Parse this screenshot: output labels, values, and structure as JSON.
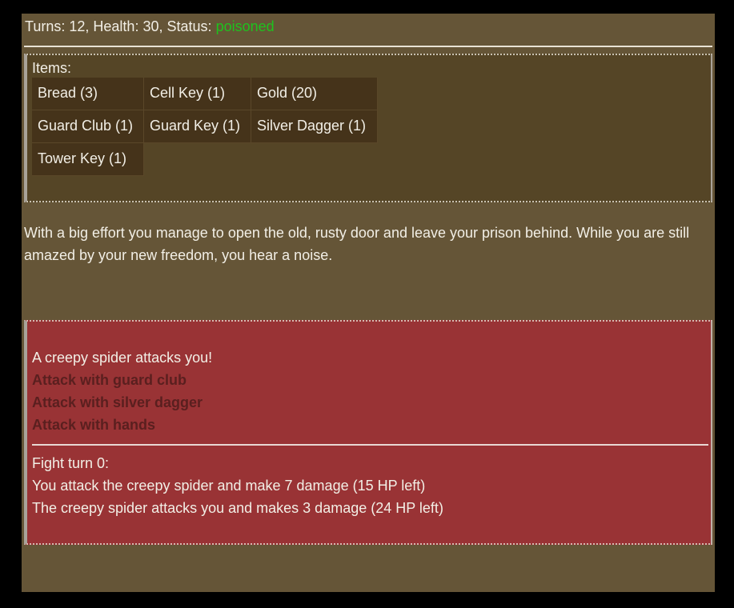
{
  "status": {
    "turns_label": "Turns:",
    "turns": "12",
    "health_label": "Health:",
    "health": "30",
    "status_label": "Status:",
    "status_value": "poisoned",
    "status_color": "#1ec21e"
  },
  "inventory": {
    "label": "Items:",
    "items": [
      {
        "name": "Bread",
        "count": 3,
        "label": "Bread (3)"
      },
      {
        "name": "Cell Key",
        "count": 1,
        "label": "Cell Key (1)"
      },
      {
        "name": "Gold",
        "count": 20,
        "label": "Gold (20)"
      },
      {
        "name": "Guard Club",
        "count": 1,
        "label": "Guard Club (1)"
      },
      {
        "name": "Guard Key",
        "count": 1,
        "label": "Guard Key (1)"
      },
      {
        "name": "Silver Dagger",
        "count": 1,
        "label": "Silver Dagger (1)"
      },
      {
        "name": "Tower Key",
        "count": 1,
        "label": "Tower Key (1)"
      }
    ]
  },
  "narrative": {
    "text": "With a big effort you manage to open the old, rusty door and leave your prison behind. While you are still amazed by your new freedom, you hear a noise."
  },
  "fight": {
    "intro": "A creepy spider attacks you!",
    "options": [
      {
        "label": "Attack with guard club"
      },
      {
        "label": "Attack with silver dagger"
      },
      {
        "label": "Attack with hands"
      }
    ],
    "log": {
      "title": "Fight turn 0:",
      "lines": [
        "You attack the creepy spider and make 7 damage (15 HP left)",
        "The creepy spider attacks you and makes 3 damage (24 HP left)"
      ]
    }
  }
}
